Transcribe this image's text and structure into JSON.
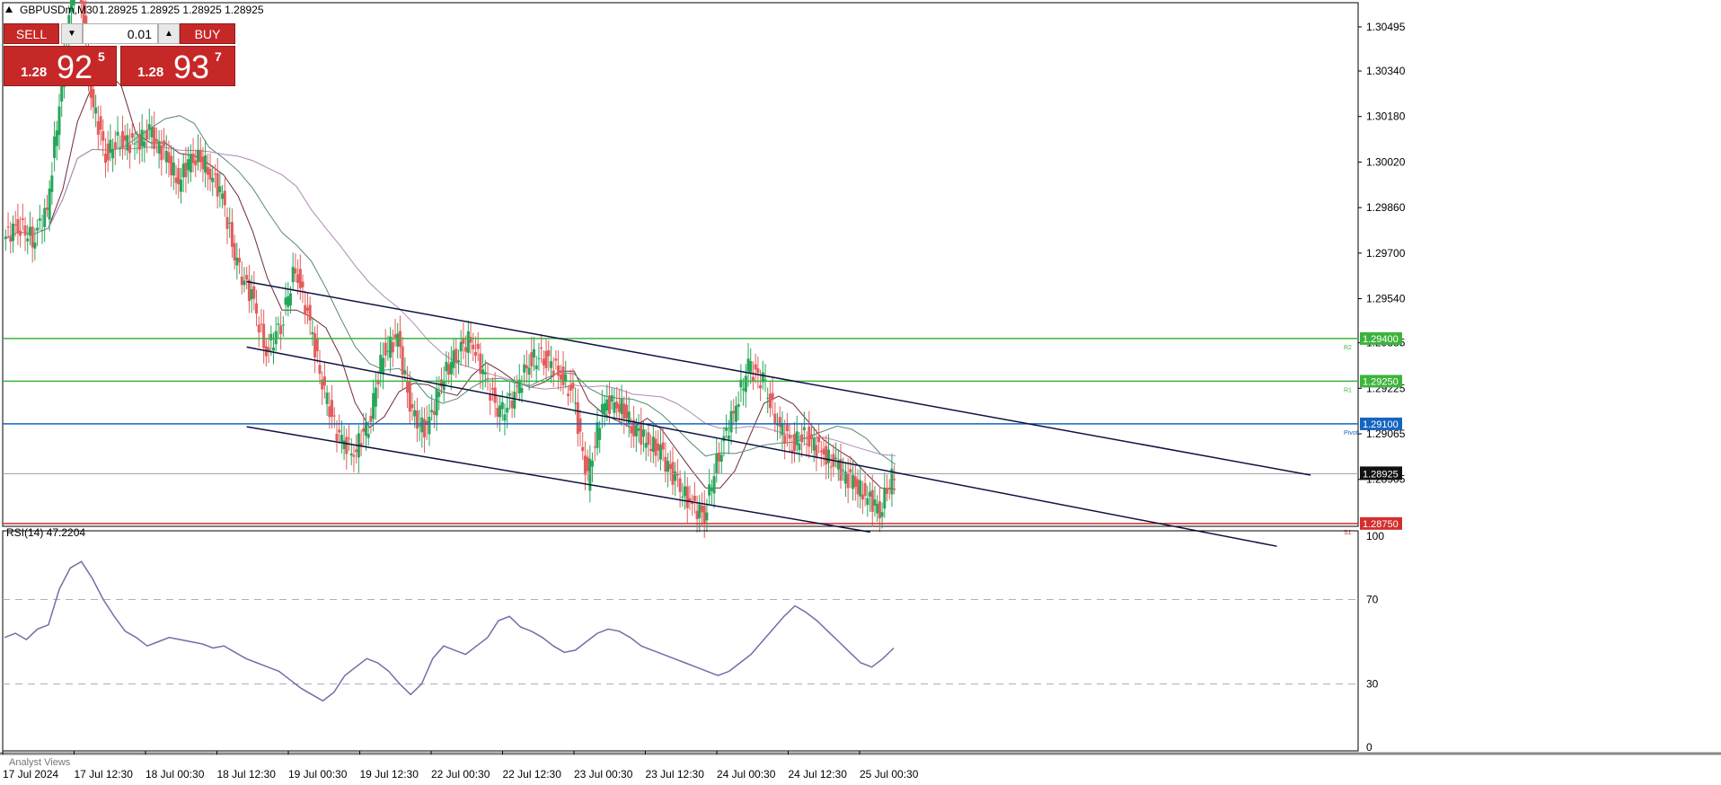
{
  "header": {
    "symbol": "GBPUSDm,M30",
    "ohlc": "1.28925 1.28925 1.28925 1.28925"
  },
  "trade_panel": {
    "sell_label": "SELL",
    "buy_label": "BUY",
    "lot": "0.01",
    "sell_prefix": "1.28",
    "sell_big": "92",
    "sell_sup": "5",
    "buy_prefix": "1.28",
    "buy_big": "93",
    "buy_sup": "7"
  },
  "indicator": {
    "title": "RSI(14) 47.2204"
  },
  "bottom_tab": "Analyst Views",
  "chart_data": [
    {
      "type": "candlestick",
      "symbol": "GBPUSDm",
      "timeframe": "M30",
      "ylim": [
        1.2874,
        1.3058
      ],
      "y_ticks": [
        "1.30495",
        "1.30340",
        "1.30180",
        "1.30020",
        "1.29860",
        "1.29700",
        "1.29540",
        "1.29385",
        "1.29225",
        "1.29065",
        "1.28905"
      ],
      "x_ticks": [
        "17 Jul 2024",
        "17 Jul 12:30",
        "18 Jul 00:30",
        "18 Jul 12:30",
        "19 Jul 00:30",
        "19 Jul 12:30",
        "22 Jul 00:30",
        "22 Jul 12:30",
        "23 Jul 00:30",
        "23 Jul 12:30",
        "24 Jul 00:30",
        "24 Jul 12:30",
        "25 Jul 00:30"
      ],
      "close_path": [
        1.2975,
        1.298,
        1.2975,
        1.2985,
        1.303,
        1.3075,
        1.3025,
        1.3005,
        1.301,
        1.3008,
        1.3012,
        1.3005,
        1.2995,
        1.3005,
        1.3,
        1.299,
        1.2965,
        1.2955,
        1.2935,
        1.2945,
        1.2965,
        1.2945,
        1.292,
        1.2905,
        1.29,
        1.291,
        1.2935,
        1.294,
        1.2912,
        1.2908,
        1.2925,
        1.2935,
        1.294,
        1.2926,
        1.2913,
        1.292,
        1.2932,
        1.2934,
        1.2928,
        1.292,
        1.289,
        1.2916,
        1.2918,
        1.291,
        1.2904,
        1.29,
        1.289,
        1.2882,
        1.2878,
        1.29,
        1.2914,
        1.293,
        1.2925,
        1.291,
        1.2903,
        1.2906,
        1.29,
        1.2895,
        1.289,
        1.2885,
        1.288,
        1.2893
      ],
      "current_price": "1.28925",
      "levels": [
        {
          "label": "1.29400",
          "price": 1.294,
          "color": "#3cb43c",
          "tag": "R2"
        },
        {
          "label": "1.29250",
          "price": 1.2925,
          "color": "#3cb43c",
          "tag": "R1"
        },
        {
          "label": "1.29100",
          "price": 1.291,
          "color": "#1565c0",
          "tag": "Pivot"
        },
        {
          "label": "1.28750",
          "price": 1.2875,
          "color": "#d32f2f",
          "tag": "S1"
        }
      ],
      "channel_lines": [
        {
          "from": [
            1.296,
            0.18
          ],
          "to": [
            1.2892,
            0.965
          ]
        },
        {
          "from": [
            1.2937,
            0.18
          ],
          "to": [
            1.2867,
            0.94
          ]
        },
        {
          "from": [
            1.2909,
            0.18
          ],
          "to": [
            1.2872,
            0.64
          ]
        }
      ]
    },
    {
      "type": "line",
      "name": "RSI(14)",
      "current_value": 47.2204,
      "ylim": [
        0,
        100
      ],
      "y_ticks": [
        100,
        70,
        30,
        0
      ],
      "levels": [
        70,
        30
      ],
      "values": [
        52,
        54,
        51,
        56,
        58,
        75,
        85,
        88,
        80,
        70,
        62,
        55,
        52,
        48,
        50,
        52,
        51,
        50,
        49,
        47,
        48,
        45,
        42,
        40,
        38,
        36,
        32,
        28,
        25,
        22,
        26,
        34,
        38,
        42,
        40,
        36,
        30,
        25,
        30,
        42,
        48,
        46,
        44,
        48,
        52,
        60,
        62,
        57,
        55,
        52,
        48,
        45,
        46,
        50,
        54,
        56,
        55,
        52,
        48,
        46,
        44,
        42,
        40,
        38,
        36,
        34,
        36,
        40,
        44,
        50,
        56,
        62,
        67,
        64,
        60,
        55,
        50,
        45,
        40,
        38,
        42,
        47
      ]
    }
  ]
}
